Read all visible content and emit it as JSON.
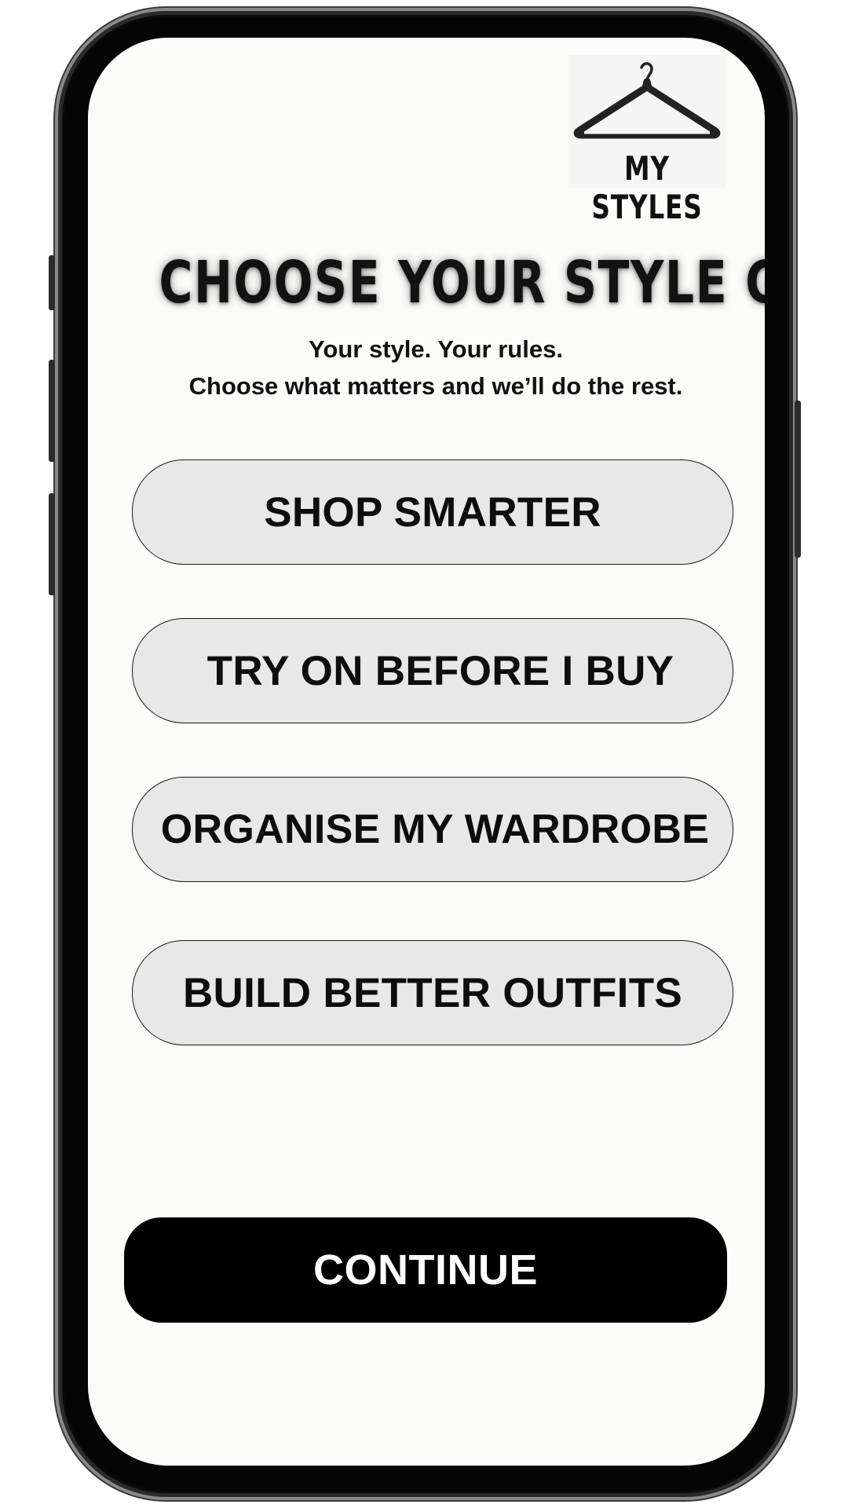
{
  "app": {
    "logo_text": "MY  STYLES",
    "logo_icon": "clothes-hanger-icon"
  },
  "header": {
    "title": "CHOOSE YOUR STYLE GOALS",
    "subtitle_line1": "Your style. Your rules.",
    "subtitle_line2": "Choose what matters and we’ll do the rest."
  },
  "options": [
    {
      "label": "SHOP SMARTER"
    },
    {
      "label": "TRY ON BEFORE I BUY"
    },
    {
      "label": "ORGANISE MY WARDROBE"
    },
    {
      "label": "BUILD BETTER OUTFITS"
    }
  ],
  "footer": {
    "continue_label": "CONTINUE"
  },
  "colors": {
    "screen_background": "#fbfbfa",
    "option_fill": "#e8e8e8",
    "primary_button": "#000000",
    "primary_button_text": "#ffffff"
  }
}
